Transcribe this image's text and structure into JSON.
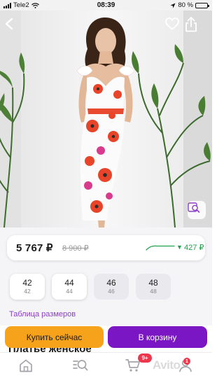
{
  "status_bar": {
    "carrier": "Tele2",
    "time": "08:39",
    "battery_percent": "80 %",
    "battery_level": 0.8
  },
  "photo": {
    "icons": [
      "back-arrow-icon",
      "heart-icon",
      "share-icon",
      "similar-search-icon"
    ]
  },
  "price": {
    "current": "5 767 ₽",
    "old": "8 900 ₽",
    "change": "427 ₽",
    "change_color": "#1fa04a"
  },
  "sizes": [
    {
      "main": "42",
      "sub": "42",
      "available": true
    },
    {
      "main": "44",
      "sub": "44",
      "available": true
    },
    {
      "main": "46",
      "sub": "46",
      "available": false
    },
    {
      "main": "48",
      "sub": "48",
      "available": false
    }
  ],
  "size_table_link": "Таблица размеров",
  "product_title_partial": "Платье женское",
  "actions": {
    "buy_now": "Купить сейчас",
    "add_to_cart": "В корзину",
    "buy_now_color": "#f7a21b",
    "add_to_cart_color": "#7b16c4"
  },
  "tabbar": {
    "items": [
      "home-icon",
      "catalog-search-icon",
      "cart-icon",
      "profile-icon"
    ],
    "cart_badge": "9+",
    "profile_badge": "1"
  },
  "watermark": "Avito",
  "accent_color": "#8b3ec6"
}
